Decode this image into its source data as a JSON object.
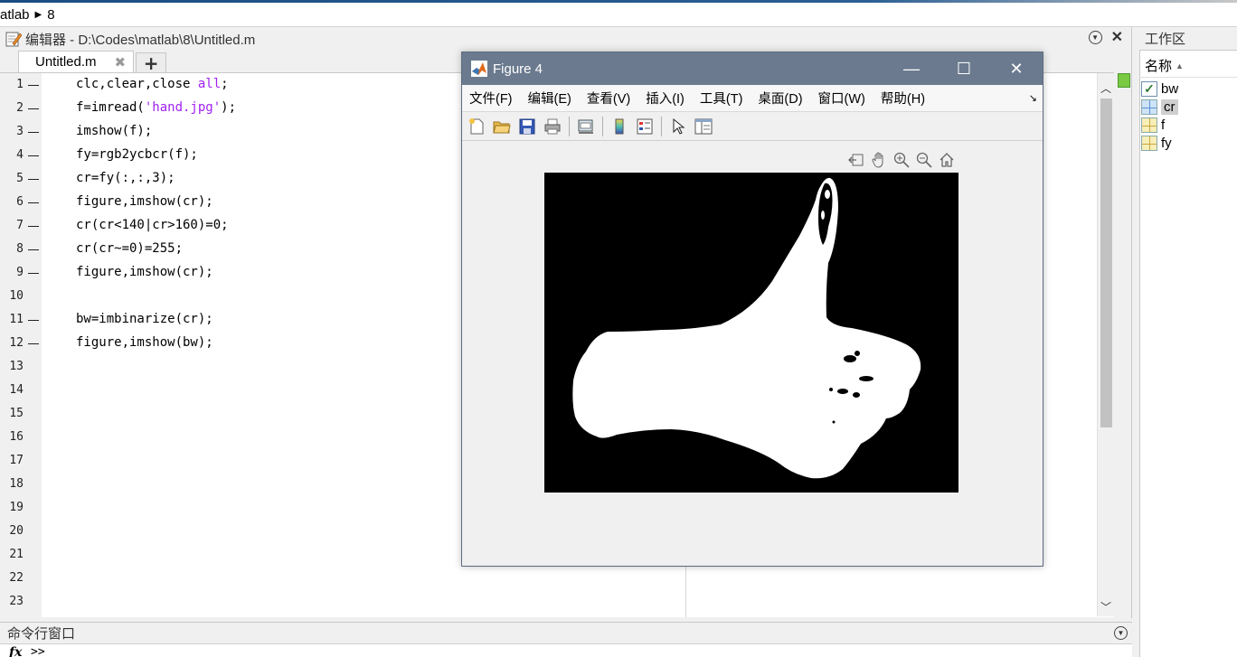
{
  "breadcrumb": {
    "part1": "atlab",
    "part2": "8"
  },
  "editor": {
    "title": "编辑器 - D:\\Codes\\matlab\\8\\Untitled.m",
    "tab_label": "Untitled.m",
    "tab_close": "✖",
    "tab_add": "+",
    "lines": [
      {
        "n": "1",
        "code": [
          {
            "t": "clc,clear,close "
          },
          {
            "t": "all",
            "s": 1
          },
          {
            "t": ";"
          }
        ]
      },
      {
        "n": "2",
        "code": [
          {
            "t": "f=imread("
          },
          {
            "t": "'hand.jpg'",
            "s": 1
          },
          {
            "t": ");"
          }
        ]
      },
      {
        "n": "3",
        "code": [
          {
            "t": "imshow(f);"
          }
        ]
      },
      {
        "n": "4",
        "code": [
          {
            "t": "fy=rgb2ycbcr(f);"
          }
        ]
      },
      {
        "n": "5",
        "code": [
          {
            "t": "cr=fy(:,:,3);"
          }
        ]
      },
      {
        "n": "6",
        "code": [
          {
            "t": "figure,imshow(cr);"
          }
        ]
      },
      {
        "n": "7",
        "code": [
          {
            "t": "cr(cr<140|cr>160)=0;"
          }
        ]
      },
      {
        "n": "8",
        "code": [
          {
            "t": "cr(cr~=0)=255;"
          }
        ]
      },
      {
        "n": "9",
        "code": [
          {
            "t": "figure,imshow(cr);"
          }
        ]
      },
      {
        "n": "10",
        "code": []
      },
      {
        "n": "11",
        "code": [
          {
            "t": "bw=imbinarize(cr);"
          }
        ]
      },
      {
        "n": "12",
        "code": [
          {
            "t": "figure,imshow(bw);"
          }
        ]
      },
      {
        "n": "13",
        "code": []
      },
      {
        "n": "14",
        "code": []
      },
      {
        "n": "15",
        "code": []
      },
      {
        "n": "16",
        "code": []
      },
      {
        "n": "17",
        "code": []
      },
      {
        "n": "18",
        "code": []
      },
      {
        "n": "19",
        "code": []
      },
      {
        "n": "20",
        "code": []
      },
      {
        "n": "21",
        "code": []
      },
      {
        "n": "22",
        "code": []
      },
      {
        "n": "23",
        "code": []
      }
    ],
    "dash_lines": [
      "1",
      "2",
      "3",
      "4",
      "5",
      "6",
      "7",
      "8",
      "9",
      "11",
      "12"
    ]
  },
  "command_window": {
    "title": "命令行窗口",
    "fx": "fx",
    "prompt": ">>"
  },
  "workspace": {
    "title": "工作区",
    "column": "名称",
    "variables": [
      {
        "name": "bw",
        "icon": "logical-check-icon"
      },
      {
        "name": "cr",
        "icon": "matrix-grid-icon",
        "selected": true
      },
      {
        "name": "f",
        "icon": "matrix-grid-icon"
      },
      {
        "name": "fy",
        "icon": "matrix-grid-icon"
      }
    ]
  },
  "figure": {
    "title": "Figure 4",
    "menus": [
      "文件(F)",
      "编辑(E)",
      "查看(V)",
      "插入(I)",
      "工具(T)",
      "桌面(D)",
      "窗口(W)",
      "帮助(H)"
    ],
    "toolbar_icons": [
      "new-figure-icon",
      "open-file-icon",
      "save-icon",
      "print-icon",
      "link-plot-icon",
      "colorbar-icon",
      "legend-icon",
      "select-pointer-icon",
      "property-inspector-icon"
    ],
    "axes_toolbar_icons": [
      "export-icon",
      "pan-icon",
      "zoom-in-icon",
      "zoom-out-icon",
      "home-icon"
    ],
    "image_colors": {
      "background": "#000000",
      "foreground": "#ffffff"
    }
  }
}
